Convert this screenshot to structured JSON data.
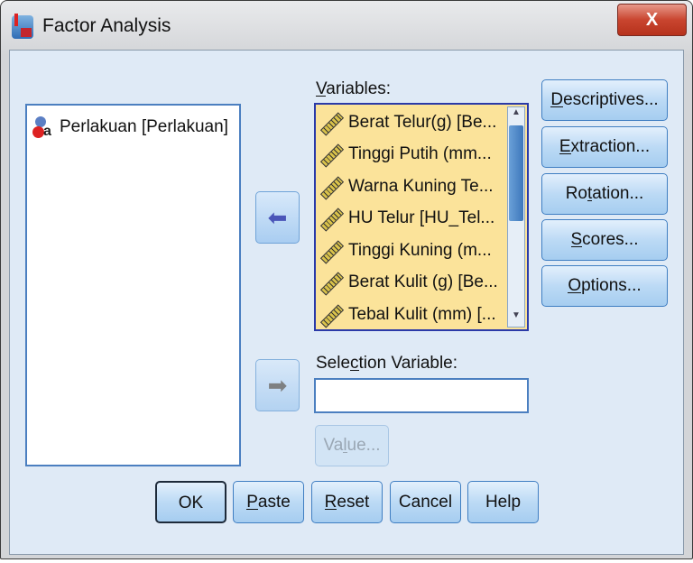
{
  "window": {
    "title": "Factor Analysis",
    "close_label": "X"
  },
  "source_list": {
    "items": [
      {
        "label": "Perlakuan [Perlakuan]",
        "icon": "nominal-variable-icon"
      }
    ]
  },
  "variables": {
    "label": "Variables:",
    "mnemonic": "V",
    "items": [
      "Berat Telur(g) [Be...",
      "Tinggi Putih (mm...",
      "Warna Kuning Te...",
      "HU Telur [HU_Tel...",
      "Tinggi Kuning (m...",
      "Berat Kulit (g) [Be...",
      "Tebal Kulit (mm) [..."
    ],
    "scroll_position_percent": 0
  },
  "selection": {
    "label": "Selection Variable:",
    "mnemonic": "c",
    "value": "",
    "value_button": {
      "label": "Value...",
      "mnemonic": "l"
    }
  },
  "side_buttons": [
    {
      "label": "Descriptives...",
      "mnemonic": "D"
    },
    {
      "label": "Extraction...",
      "mnemonic": "E"
    },
    {
      "label": "Rotation...",
      "mnemonic": "t"
    },
    {
      "label": "Scores...",
      "mnemonic": "S"
    },
    {
      "label": "Options...",
      "mnemonic": "O"
    }
  ],
  "bottom_buttons": [
    {
      "label": "OK",
      "mnemonic": ""
    },
    {
      "label": "Paste",
      "mnemonic": "P"
    },
    {
      "label": "Reset",
      "mnemonic": "R"
    },
    {
      "label": "Cancel",
      "mnemonic": ""
    },
    {
      "label": "Help",
      "mnemonic": ""
    }
  ],
  "colors": {
    "selection_bg": "#fbe39a",
    "accent": "#3f7ec2"
  }
}
